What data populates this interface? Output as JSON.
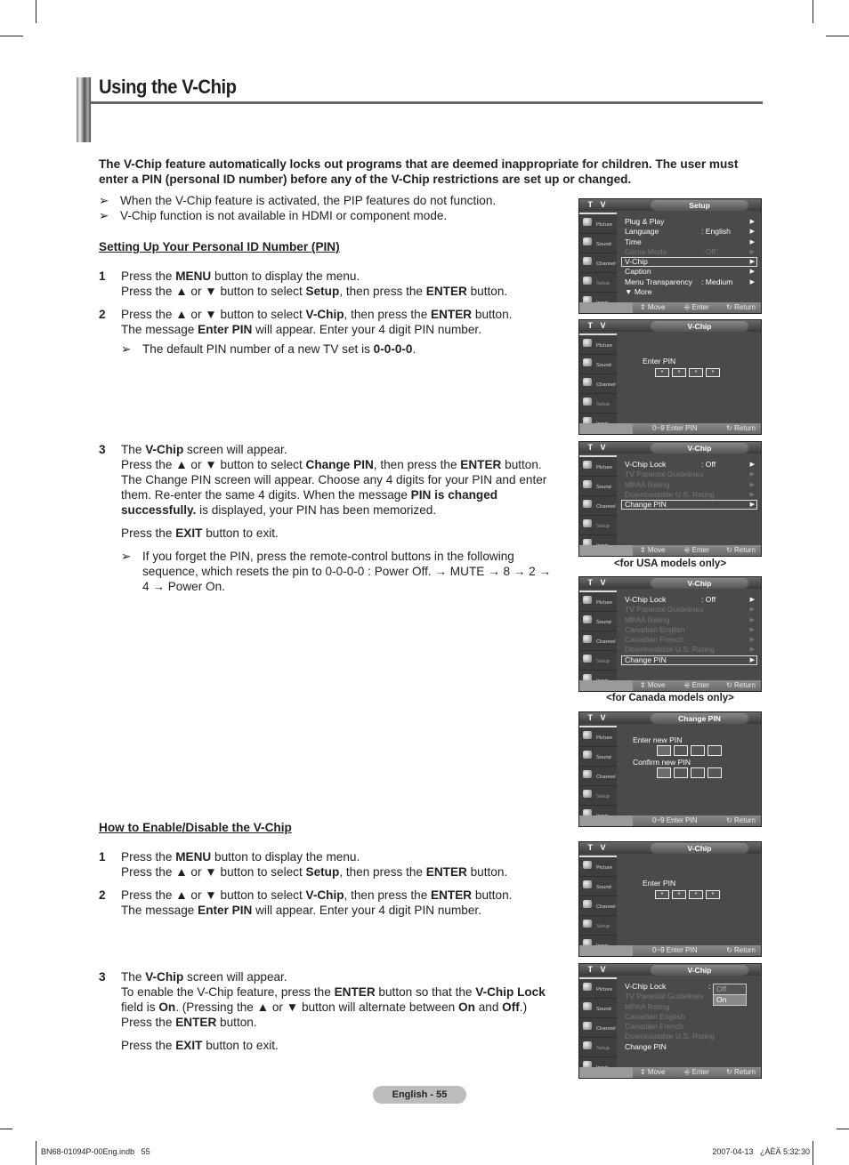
{
  "title": "Using the V-Chip",
  "intro": "The V-Chip feature automatically locks out programs that are deemed inappropriate for children. The user must enter a PIN (personal ID number) before any of the V-Chip restrictions are set up or changed.",
  "notes": [
    "When the V-Chip feature is activated, the PIP features do not function.",
    "V-Chip function is not available in HDMI or component mode."
  ],
  "section1": {
    "heading": "Setting Up Your Personal ID Number (PIN)",
    "steps": [
      {
        "num": "1",
        "l1a": "Press the ",
        "l1b": "MENU",
        "l1c": " button to display the menu.",
        "l2a": "Press the ▲ or ▼ button to select ",
        "l2b": "Setup",
        "l2c": ", then press the ",
        "l2d": "ENTER",
        "l2e": " button."
      },
      {
        "num": "2",
        "l1a": "Press the ▲ or ▼ button to select ",
        "l1b": "V-Chip",
        "l1c": ", then press the ",
        "l1d": "ENTER",
        "l1e": " button.",
        "l2a": "The message ",
        "l2b": "Enter PIN",
        "l2c": " will appear. Enter your 4 digit PIN number.",
        "note_a": "The default PIN number of a new TV set is ",
        "note_b": "0-0-0-0",
        "note_c": "."
      },
      {
        "num": "3",
        "l1a": "The ",
        "l1b": "V-Chip",
        "l1c": " screen will appear.",
        "l2a": "Press the ▲ or ▼ button to select ",
        "l2b": "Change PIN",
        "l2c": ", then press the ",
        "l2d": "ENTER",
        "l2e": " button.",
        "l3a": "The Change PIN screen will appear. Choose any 4 digits for your PIN and enter them. Re-enter the same 4 digits. When the message ",
        "l3b": "PIN is changed successfully.",
        "l3c": " is displayed, your PIN has been memorized.",
        "exit_a": "Press the ",
        "exit_b": "EXIT",
        "exit_c": " button to exit.",
        "note": "If you forget the PIN, press the remote-control buttons in the following sequence, which resets the pin to 0-0-0-0 : Power Off. → MUTE → 8 → 2 → 4 → Power On."
      }
    ]
  },
  "section2": {
    "heading": "How to Enable/Disable the V-Chip",
    "steps": [
      {
        "num": "1",
        "l1a": "Press the ",
        "l1b": "MENU",
        "l1c": " button to display the menu.",
        "l2a": "Press the ▲ or ▼ button to select ",
        "l2b": "Setup",
        "l2c": ", then press the ",
        "l2d": "ENTER",
        "l2e": " button."
      },
      {
        "num": "2",
        "l1a": "Press the ▲ or ▼ button to select ",
        "l1b": "V-Chip",
        "l1c": ", then press the ",
        "l1d": "ENTER",
        "l1e": " button.",
        "l2a": "The message ",
        "l2b": "Enter PIN",
        "l2c": " will appear. Enter your 4 digit PIN number."
      },
      {
        "num": "3",
        "l1a": "The ",
        "l1b": "V-Chip",
        "l1c": " screen will appear.",
        "l2a": "To enable the V-Chip feature, press the ",
        "l2b": "ENTER",
        "l2c": " button so that the ",
        "l2d": "V-Chip Lock",
        "l3a": " field is ",
        "l3b": "On",
        "l3c": ". (Pressing the ▲ or ▼ button will alternate between ",
        "l3d": "On",
        "l3e": " and ",
        "l3f": "Off",
        "l3g": ".)",
        "l4a": "Press the ",
        "l4b": "ENTER",
        "l4c": " button.",
        "exit_a": "Press the ",
        "exit_b": "EXIT",
        "exit_c": " button to exit."
      }
    ]
  },
  "tv": {
    "tv_label": "T V",
    "sidebar": [
      "Picture",
      "Sound",
      "Channel",
      "Setup",
      "Input"
    ],
    "footer_move": "Move",
    "footer_enter": "Enter",
    "footer_return": "Return",
    "footer_pin": "0~9 Enter PIN",
    "enter_pin": "Enter PIN",
    "pin_mask": "*",
    "setup": {
      "tab": "Setup",
      "rows": [
        {
          "label": "Plug & Play",
          "value": ""
        },
        {
          "label": "Language",
          "value": ": English"
        },
        {
          "label": "Time",
          "value": ""
        },
        {
          "label": "Game Mode",
          "value": ": Off"
        },
        {
          "label": "V-Chip",
          "value": ""
        },
        {
          "label": "Caption",
          "value": ""
        },
        {
          "label": "Menu Transparency",
          "value": ": Medium"
        },
        {
          "label": "More",
          "value": ""
        }
      ]
    },
    "vchip_tab": "V-Chip",
    "vchip_usa": [
      {
        "label": "V-Chip Lock",
        "value": ": Off"
      },
      {
        "label": "TV Parental Guidelines",
        "value": ""
      },
      {
        "label": "MPAA Rating",
        "value": ""
      },
      {
        "label": "Downloadable U.S. Rating",
        "value": ""
      },
      {
        "label": "Change PIN",
        "value": ""
      }
    ],
    "vchip_canada": [
      {
        "label": "V-Chip Lock",
        "value": ": Off"
      },
      {
        "label": "TV Parental Guidelines",
        "value": ""
      },
      {
        "label": "MPAA Rating",
        "value": ""
      },
      {
        "label": "Canadian English",
        "value": ""
      },
      {
        "label": "Canadian French",
        "value": ""
      },
      {
        "label": "Downloadable U.S. Rating",
        "value": ""
      },
      {
        "label": "Change PIN",
        "value": ""
      }
    ],
    "change_pin": {
      "tab": "Change PIN",
      "new": "Enter new PIN",
      "confirm": "Confirm new PIN"
    },
    "lock_dropdown": {
      "colon": ":",
      "options": [
        "Off",
        "On"
      ]
    },
    "caption_usa": "<for USA models only>",
    "caption_canada": "<for Canada models only>"
  },
  "footer": {
    "page": "English - 55",
    "file": "BN68-01094P-00Eng.indb   55",
    "timestamp": "2007-04-13   ¿ÀÈÄ 5:32:30"
  }
}
